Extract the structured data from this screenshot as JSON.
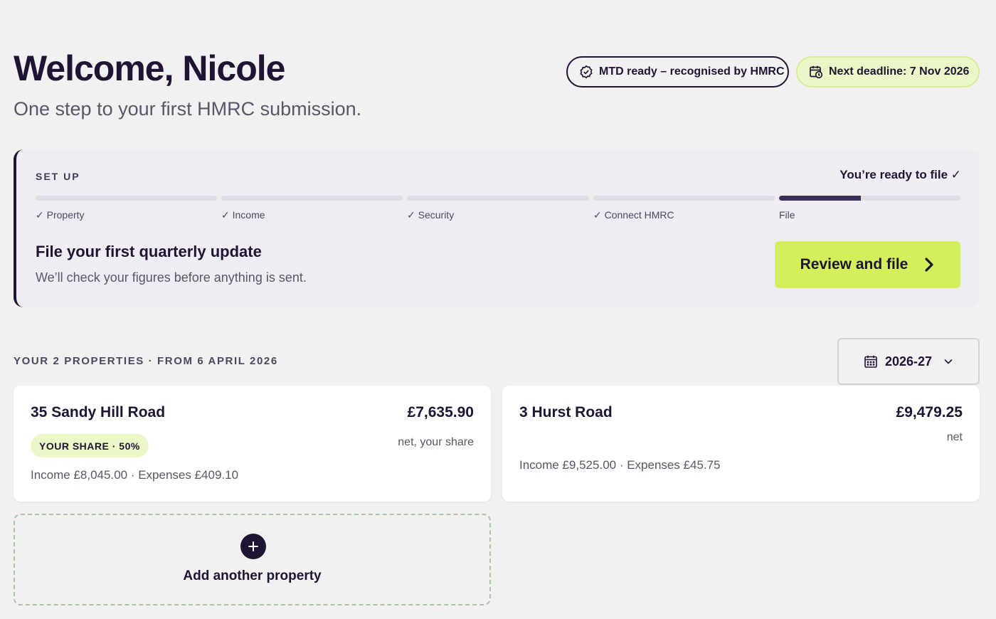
{
  "header": {
    "title": "Welcome, Nicole",
    "subtitle": "One step to your first HMRC submission.",
    "mtd_badge": {
      "label": "MTD ready – recognised by HMRC",
      "icon": "check-badge-icon"
    },
    "deadline_badge": {
      "label": "Next deadline: 7 Nov 2026",
      "icon": "calendar-clock-icon"
    }
  },
  "setup": {
    "label": "SET UP",
    "status": "You’re ready to file ✓",
    "steps": [
      {
        "label": "✓ Property",
        "progress": 0
      },
      {
        "label": "✓ Income",
        "progress": 0
      },
      {
        "label": "✓ Security",
        "progress": 0
      },
      {
        "label": "✓ Connect HMRC",
        "progress": 0
      },
      {
        "label": "File",
        "progress": 0.45
      }
    ],
    "heading": "File your first quarterly update",
    "description": "We’ll check your figures before anything is sent.",
    "button_label": "Review and file"
  },
  "properties": {
    "section_label": "YOUR 2 PROPERTIES · FROM 6 APRIL 2026",
    "year_select": {
      "value": "2026-27",
      "icon": "calendar-icon"
    },
    "items": [
      {
        "name": "35 Sandy Hill Road",
        "amount": "£7,635.90",
        "note": "net, your share",
        "share": "YOUR SHARE · 50%",
        "detail": "Income £8,045.00 · Expenses £409.10"
      },
      {
        "name": "3 Hurst Road",
        "amount": "£9,479.25",
        "note": "net",
        "detail": "Income £9,525.00 · Expenses £45.75"
      }
    ],
    "add_label": "Add another property"
  },
  "colors": {
    "ink": "#1e1433",
    "accent_lime": "#d3ef5b",
    "badge_lime": "#ecf7c8",
    "progress_fill": "#3b2f57"
  }
}
